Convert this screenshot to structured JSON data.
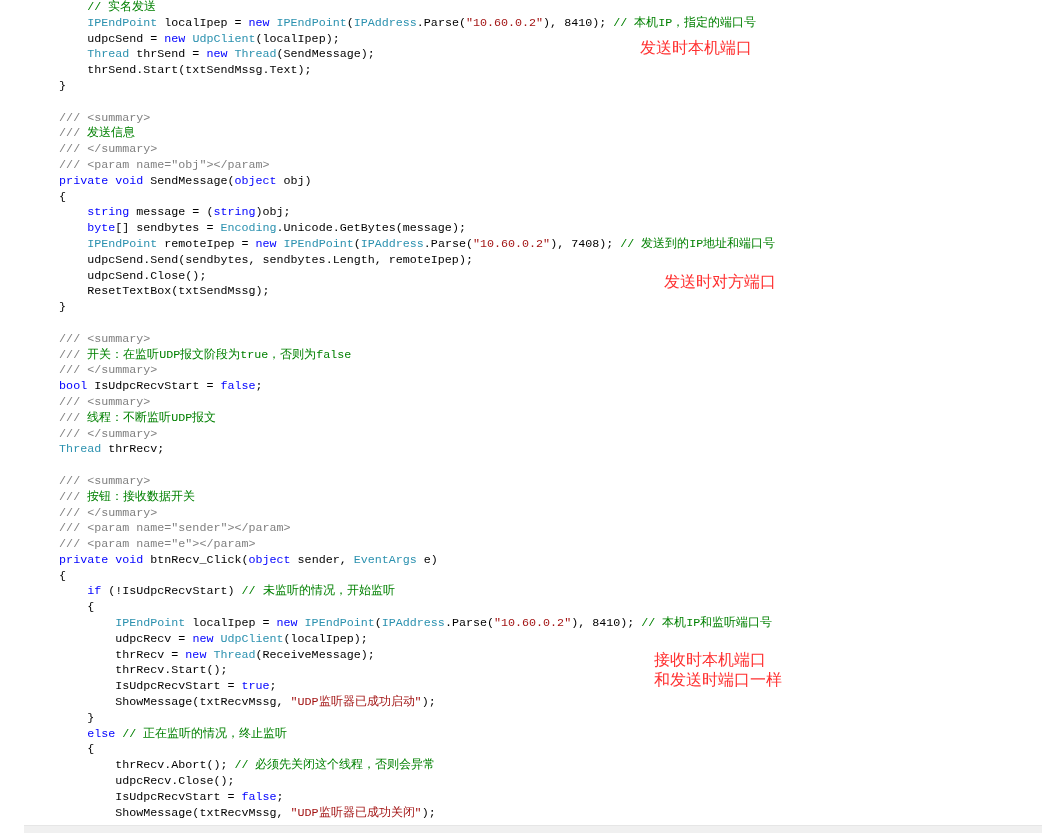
{
  "code_lines": [
    {
      "kind": "code",
      "tokens": [
        {
          "kind": "comment",
          "text": "            // 实名发送"
        }
      ]
    },
    {
      "kind": "code",
      "tokens": [
        {
          "kind": "type",
          "text": "            IPEndPoint"
        },
        {
          "kind": "plain",
          "text": " localIpep = "
        },
        {
          "kind": "keyword",
          "text": "new"
        },
        {
          "kind": "type",
          "text": " IPEndPoint"
        },
        {
          "kind": "plain",
          "text": "("
        },
        {
          "kind": "type",
          "text": "IPAddress"
        },
        {
          "kind": "plain",
          "text": ".Parse("
        },
        {
          "kind": "string",
          "text": "\"10.60.0.2\""
        },
        {
          "kind": "plain",
          "text": "), 8410); "
        },
        {
          "kind": "comment",
          "text": "// 本机IP，指定的端口号"
        }
      ]
    },
    {
      "kind": "code",
      "tokens": [
        {
          "kind": "plain",
          "text": "            udpcSend = "
        },
        {
          "kind": "keyword",
          "text": "new"
        },
        {
          "kind": "type",
          "text": " UdpClient"
        },
        {
          "kind": "plain",
          "text": "(localIpep);"
        }
      ]
    },
    {
      "kind": "code",
      "tokens": [
        {
          "kind": "type",
          "text": "            Thread"
        },
        {
          "kind": "plain",
          "text": " thrSend = "
        },
        {
          "kind": "keyword",
          "text": "new"
        },
        {
          "kind": "type",
          "text": " Thread"
        },
        {
          "kind": "plain",
          "text": "(SendMessage);"
        }
      ]
    },
    {
      "kind": "code",
      "tokens": [
        {
          "kind": "plain",
          "text": "            thrSend.Start(txtSendMssg.Text);"
        }
      ]
    },
    {
      "kind": "code",
      "tokens": [
        {
          "kind": "plain",
          "text": "        }"
        }
      ]
    },
    {
      "kind": "blank"
    },
    {
      "kind": "code",
      "tokens": [
        {
          "kind": "doc",
          "text": "        /// <summary>"
        }
      ]
    },
    {
      "kind": "code",
      "tokens": [
        {
          "kind": "doc",
          "text": "        /// "
        },
        {
          "kind": "comment",
          "text": "发送信息"
        }
      ]
    },
    {
      "kind": "code",
      "tokens": [
        {
          "kind": "doc",
          "text": "        /// </summary>"
        }
      ]
    },
    {
      "kind": "code",
      "tokens": [
        {
          "kind": "doc",
          "text": "        /// <param name=\"obj\"></param>"
        }
      ]
    },
    {
      "kind": "code",
      "tokens": [
        {
          "kind": "keyword",
          "text": "        private void"
        },
        {
          "kind": "plain",
          "text": " SendMessage("
        },
        {
          "kind": "keyword",
          "text": "object"
        },
        {
          "kind": "plain",
          "text": " obj)"
        }
      ]
    },
    {
      "kind": "code",
      "tokens": [
        {
          "kind": "plain",
          "text": "        {"
        }
      ]
    },
    {
      "kind": "code",
      "tokens": [
        {
          "kind": "keyword",
          "text": "            string"
        },
        {
          "kind": "plain",
          "text": " message = ("
        },
        {
          "kind": "keyword",
          "text": "string"
        },
        {
          "kind": "plain",
          "text": ")obj;"
        }
      ]
    },
    {
      "kind": "code",
      "tokens": [
        {
          "kind": "keyword",
          "text": "            byte"
        },
        {
          "kind": "plain",
          "text": "[] sendbytes = "
        },
        {
          "kind": "type",
          "text": "Encoding"
        },
        {
          "kind": "plain",
          "text": ".Unicode.GetBytes(message);"
        }
      ]
    },
    {
      "kind": "code",
      "tokens": [
        {
          "kind": "type",
          "text": "            IPEndPoint"
        },
        {
          "kind": "plain",
          "text": " remoteIpep = "
        },
        {
          "kind": "keyword",
          "text": "new"
        },
        {
          "kind": "type",
          "text": " IPEndPoint"
        },
        {
          "kind": "plain",
          "text": "("
        },
        {
          "kind": "type",
          "text": "IPAddress"
        },
        {
          "kind": "plain",
          "text": ".Parse("
        },
        {
          "kind": "string",
          "text": "\"10.60.0.2\""
        },
        {
          "kind": "plain",
          "text": "), 7408); "
        },
        {
          "kind": "comment",
          "text": "// 发送到的IP地址和端口号"
        }
      ]
    },
    {
      "kind": "code",
      "tokens": [
        {
          "kind": "plain",
          "text": "            udpcSend.Send(sendbytes, sendbytes.Length, remoteIpep);"
        }
      ]
    },
    {
      "kind": "code",
      "tokens": [
        {
          "kind": "plain",
          "text": "            udpcSend.Close();"
        }
      ]
    },
    {
      "kind": "code",
      "tokens": [
        {
          "kind": "plain",
          "text": "            ResetTextBox(txtSendMssg);"
        }
      ]
    },
    {
      "kind": "code",
      "tokens": [
        {
          "kind": "plain",
          "text": "        }"
        }
      ]
    },
    {
      "kind": "blank"
    },
    {
      "kind": "code",
      "tokens": [
        {
          "kind": "doc",
          "text": "        /// <summary>"
        }
      ]
    },
    {
      "kind": "code",
      "tokens": [
        {
          "kind": "doc",
          "text": "        /// "
        },
        {
          "kind": "comment",
          "text": "开关：在监听UDP报文阶段为true，否则为false"
        }
      ]
    },
    {
      "kind": "code",
      "tokens": [
        {
          "kind": "doc",
          "text": "        /// </summary>"
        }
      ]
    },
    {
      "kind": "code",
      "tokens": [
        {
          "kind": "keyword",
          "text": "        bool"
        },
        {
          "kind": "plain",
          "text": " IsUdpcRecvStart = "
        },
        {
          "kind": "keyword",
          "text": "false"
        },
        {
          "kind": "plain",
          "text": ";"
        }
      ]
    },
    {
      "kind": "code",
      "tokens": [
        {
          "kind": "doc",
          "text": "        /// <summary>"
        }
      ]
    },
    {
      "kind": "code",
      "tokens": [
        {
          "kind": "doc",
          "text": "        /// "
        },
        {
          "kind": "comment",
          "text": "线程：不断监听UDP报文"
        }
      ]
    },
    {
      "kind": "code",
      "tokens": [
        {
          "kind": "doc",
          "text": "        /// </summary>"
        }
      ]
    },
    {
      "kind": "code",
      "tokens": [
        {
          "kind": "type",
          "text": "        Thread"
        },
        {
          "kind": "plain",
          "text": " thrRecv;"
        }
      ]
    },
    {
      "kind": "blank"
    },
    {
      "kind": "code",
      "tokens": [
        {
          "kind": "doc",
          "text": "        /// <summary>"
        }
      ]
    },
    {
      "kind": "code",
      "tokens": [
        {
          "kind": "doc",
          "text": "        /// "
        },
        {
          "kind": "comment",
          "text": "按钮：接收数据开关"
        }
      ]
    },
    {
      "kind": "code",
      "tokens": [
        {
          "kind": "doc",
          "text": "        /// </summary>"
        }
      ]
    },
    {
      "kind": "code",
      "tokens": [
        {
          "kind": "doc",
          "text": "        /// <param name=\"sender\"></param>"
        }
      ]
    },
    {
      "kind": "code",
      "tokens": [
        {
          "kind": "doc",
          "text": "        /// <param name=\"e\"></param>"
        }
      ]
    },
    {
      "kind": "code",
      "tokens": [
        {
          "kind": "keyword",
          "text": "        private void"
        },
        {
          "kind": "plain",
          "text": " btnRecv_Click("
        },
        {
          "kind": "keyword",
          "text": "object"
        },
        {
          "kind": "plain",
          "text": " sender, "
        },
        {
          "kind": "type",
          "text": "EventArgs"
        },
        {
          "kind": "plain",
          "text": " e)"
        }
      ]
    },
    {
      "kind": "code",
      "tokens": [
        {
          "kind": "plain",
          "text": "        {"
        }
      ]
    },
    {
      "kind": "code",
      "tokens": [
        {
          "kind": "keyword",
          "text": "            if"
        },
        {
          "kind": "plain",
          "text": " (!IsUdpcRecvStart) "
        },
        {
          "kind": "comment",
          "text": "// 未监听的情况，开始监听"
        }
      ]
    },
    {
      "kind": "code",
      "tokens": [
        {
          "kind": "plain",
          "text": "            {"
        }
      ]
    },
    {
      "kind": "code",
      "tokens": [
        {
          "kind": "type",
          "text": "                IPEndPoint"
        },
        {
          "kind": "plain",
          "text": " localIpep = "
        },
        {
          "kind": "keyword",
          "text": "new"
        },
        {
          "kind": "type",
          "text": " IPEndPoint"
        },
        {
          "kind": "plain",
          "text": "("
        },
        {
          "kind": "type",
          "text": "IPAddress"
        },
        {
          "kind": "plain",
          "text": ".Parse("
        },
        {
          "kind": "string",
          "text": "\"10.60.0.2\""
        },
        {
          "kind": "plain",
          "text": "), 8410); "
        },
        {
          "kind": "comment",
          "text": "// 本机IP和监听端口号"
        }
      ]
    },
    {
      "kind": "code",
      "tokens": [
        {
          "kind": "plain",
          "text": "                udpcRecv = "
        },
        {
          "kind": "keyword",
          "text": "new"
        },
        {
          "kind": "type",
          "text": " UdpClient"
        },
        {
          "kind": "plain",
          "text": "(localIpep);"
        }
      ]
    },
    {
      "kind": "code",
      "tokens": [
        {
          "kind": "plain",
          "text": "                thrRecv = "
        },
        {
          "kind": "keyword",
          "text": "new"
        },
        {
          "kind": "type",
          "text": " Thread"
        },
        {
          "kind": "plain",
          "text": "(ReceiveMessage);"
        }
      ]
    },
    {
      "kind": "code",
      "tokens": [
        {
          "kind": "plain",
          "text": "                thrRecv.Start();"
        }
      ]
    },
    {
      "kind": "code",
      "tokens": [
        {
          "kind": "plain",
          "text": "                IsUdpcRecvStart = "
        },
        {
          "kind": "keyword",
          "text": "true"
        },
        {
          "kind": "plain",
          "text": ";"
        }
      ]
    },
    {
      "kind": "code",
      "tokens": [
        {
          "kind": "plain",
          "text": "                ShowMessage(txtRecvMssg, "
        },
        {
          "kind": "string",
          "text": "\"UDP监听器已成功启动\""
        },
        {
          "kind": "plain",
          "text": ");"
        }
      ]
    },
    {
      "kind": "code",
      "tokens": [
        {
          "kind": "plain",
          "text": "            }"
        }
      ]
    },
    {
      "kind": "code",
      "tokens": [
        {
          "kind": "keyword",
          "text": "            else"
        },
        {
          "kind": "comment",
          "text": " // 正在监听的情况，终止监听"
        }
      ]
    },
    {
      "kind": "code",
      "tokens": [
        {
          "kind": "plain",
          "text": "            {"
        }
      ]
    },
    {
      "kind": "code",
      "tokens": [
        {
          "kind": "plain",
          "text": "                thrRecv.Abort(); "
        },
        {
          "kind": "comment",
          "text": "// 必须先关闭这个线程，否则会异常"
        }
      ]
    },
    {
      "kind": "code",
      "tokens": [
        {
          "kind": "plain",
          "text": "                udpcRecv.Close();"
        }
      ]
    },
    {
      "kind": "code",
      "tokens": [
        {
          "kind": "plain",
          "text": "                IsUdpcRecvStart = "
        },
        {
          "kind": "keyword",
          "text": "false"
        },
        {
          "kind": "plain",
          "text": ";"
        }
      ]
    },
    {
      "kind": "code",
      "tokens": [
        {
          "kind": "plain",
          "text": "                ShowMessage(txtRecvMssg, "
        },
        {
          "kind": "string",
          "text": "\"UDP监听器已成功关闭\""
        },
        {
          "kind": "plain",
          "text": ");"
        }
      ]
    }
  ],
  "annotations": [
    {
      "lines": [
        "发送时本机端口"
      ]
    },
    {
      "lines": [
        "发送时对方端口"
      ]
    },
    {
      "lines": [
        "接收时本机端口",
        "和发送时端口一样"
      ]
    }
  ]
}
